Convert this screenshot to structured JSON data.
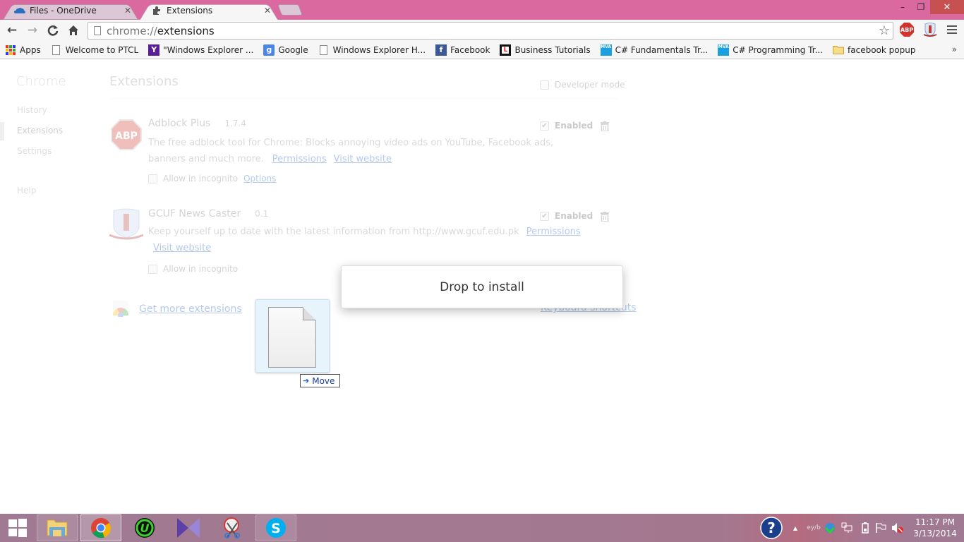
{
  "window": {
    "tabs": [
      {
        "label": "Files - OneDrive",
        "icon": "onedrive-cloud-icon",
        "active": false
      },
      {
        "label": "Extensions",
        "icon": "puzzle-piece-icon",
        "active": true
      }
    ],
    "controls": {
      "minimize": "–",
      "maximize": "❐",
      "close": "✕"
    }
  },
  "toolbar": {
    "url_scheme": "chrome://",
    "url_path": "extensions",
    "back": "←",
    "forward": "→",
    "reload": "C",
    "home": "⌂",
    "star": "☆",
    "abp_label": "ABP"
  },
  "bookmarks": {
    "items": [
      {
        "label": "Apps",
        "icon": "apps-grid-icon"
      },
      {
        "label": "Welcome to PTCL",
        "icon": "page-icon"
      },
      {
        "label": "\"Windows Explorer ...",
        "icon": "yahoo-icon"
      },
      {
        "label": "Google",
        "icon": "google-icon"
      },
      {
        "label": "Windows Explorer H...",
        "icon": "page-icon"
      },
      {
        "label": "Facebook",
        "icon": "facebook-icon"
      },
      {
        "label": "Business Tutorials",
        "icon": "lynda-icon"
      },
      {
        "label": "C# Fundamentals Tr...",
        "icon": "mva-icon"
      },
      {
        "label": "C# Programming Tr...",
        "icon": "mva-icon"
      },
      {
        "label": "facebook popup",
        "icon": "folder-icon"
      }
    ],
    "more": "»"
  },
  "sidebar": {
    "title": "Chrome",
    "items": [
      {
        "label": "History"
      },
      {
        "label": "Extensions",
        "selected": true
      },
      {
        "label": "Settings"
      },
      {
        "label": "Help"
      }
    ]
  },
  "main": {
    "title": "Extensions",
    "developer_mode_label": "Developer mode",
    "developer_mode_checked": false,
    "extensions": [
      {
        "name": "Adblock Plus",
        "version": "1.7.4",
        "description_line1": "The free adblock tool for Chrome: Blocks annoying video ads on YouTube, Facebook ads,",
        "description_line2": "banners and much more.",
        "links": [
          "Permissions",
          "Visit website"
        ],
        "incognito_label": "Allow in incognito",
        "incognito_checked": false,
        "options_label": "Options",
        "enabled_label": "Enabled",
        "enabled": true
      },
      {
        "name": "GCUF News Caster",
        "version": "0.1",
        "description_line1": "Keep yourself up to date with the latest information from http://www.gcuf.edu.pk",
        "links": [
          "Permissions",
          "Visit website"
        ],
        "incognito_label": "Allow in incognito",
        "incognito_checked": false,
        "enabled_label": "Enabled",
        "enabled": true
      }
    ],
    "get_more_label": "Get more extensions",
    "keyboard_shortcuts_label": "Keyboard shortcuts"
  },
  "overlay": {
    "drop_message": "Drop to install",
    "drag_tooltip": "Move",
    "drag_arrow": "➔"
  },
  "taskbar": {
    "apps": [
      {
        "name": "file-explorer"
      },
      {
        "name": "chrome",
        "active": true
      },
      {
        "name": "iobit-uninstaller"
      },
      {
        "name": "kmplayer"
      },
      {
        "name": "snipping-tool"
      },
      {
        "name": "skype"
      }
    ],
    "tray": {
      "help": "?",
      "expand": "▲",
      "lang": "ey/b"
    },
    "time": "11:17 PM",
    "date": "3/13/2014"
  },
  "colors": {
    "titlebar": "#d9699f",
    "close_button": "#c75050",
    "link": "#1155cc",
    "abp_red": "#d0332b",
    "taskbar": "#a07a92"
  }
}
